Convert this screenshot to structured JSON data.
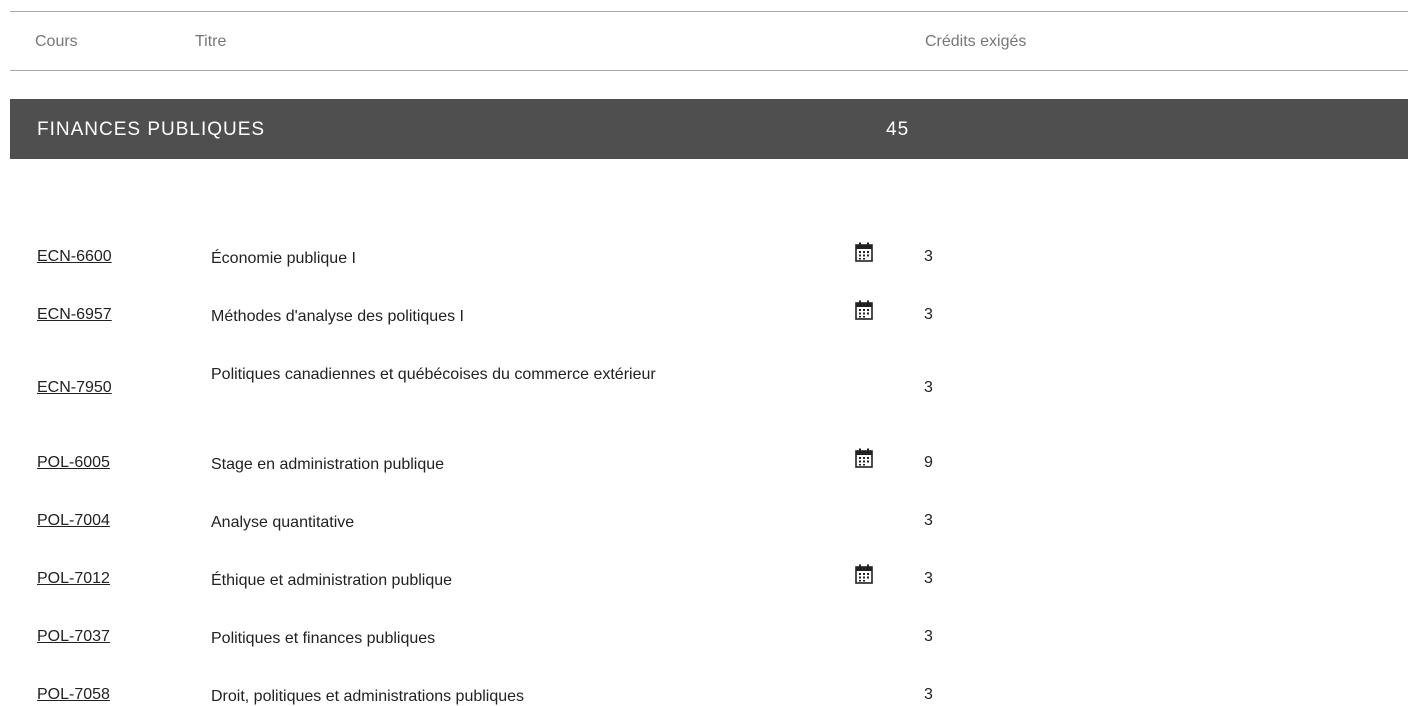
{
  "table_header": {
    "course_label": "Cours",
    "title_label": "Titre",
    "credits_label": "Crédits exigés"
  },
  "section": {
    "name": "FINANCES PUBLIQUES",
    "credits": "45"
  },
  "icons": {
    "calendar": "calendar-icon"
  },
  "courses": [
    {
      "code": "ECN-6600",
      "title": "Économie publique I",
      "calendar": true,
      "credits": "3"
    },
    {
      "code": "ECN-6957",
      "title": "Méthodes d'analyse des politiques I",
      "calendar": true,
      "credits": "3"
    },
    {
      "code": "ECN-7950",
      "title": "Politiques canadiennes et québécoises du commerce extérieur",
      "calendar": false,
      "credits": "3"
    },
    {
      "code": "POL-6005",
      "title": "Stage en administration publique",
      "calendar": true,
      "credits": "9"
    },
    {
      "code": "POL-7004",
      "title": "Analyse quantitative",
      "calendar": false,
      "credits": "3"
    },
    {
      "code": "POL-7012",
      "title": "Éthique et administration publique",
      "calendar": true,
      "credits": "3"
    },
    {
      "code": "POL-7037",
      "title": "Politiques et finances publiques",
      "calendar": false,
      "credits": "3"
    },
    {
      "code": "POL-7058",
      "title": "Droit, politiques et administrations publiques",
      "calendar": false,
      "credits": "3"
    }
  ]
}
